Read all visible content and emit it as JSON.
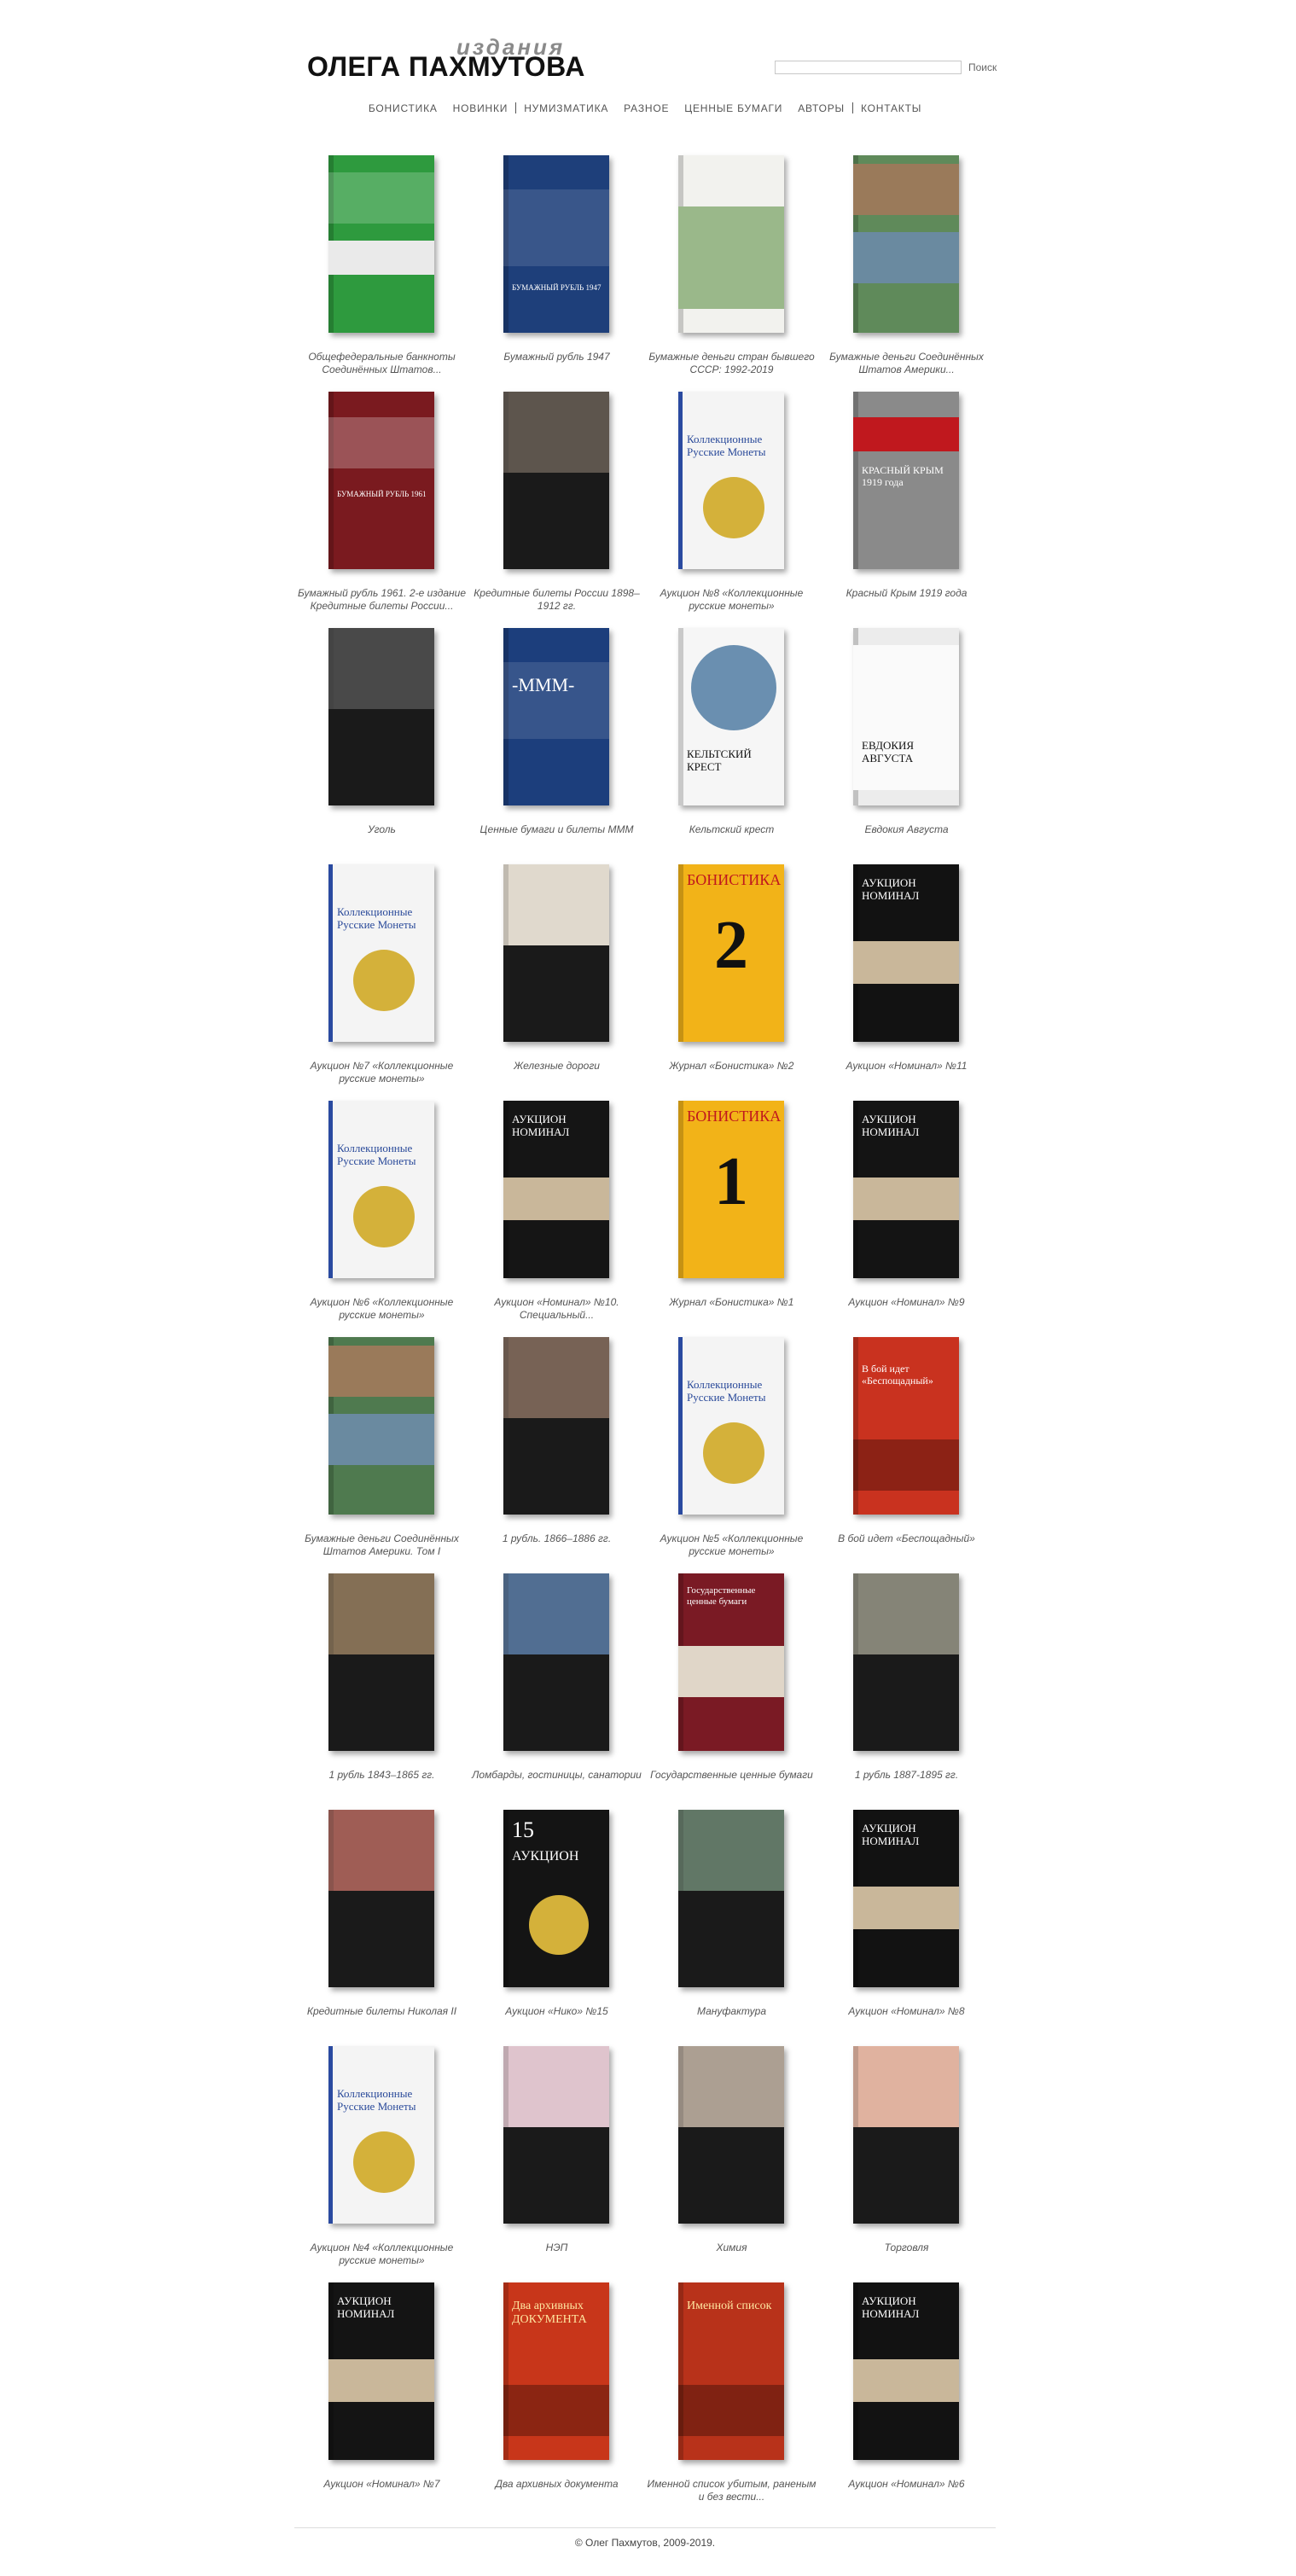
{
  "header": {
    "logo_top": "издания",
    "logo_main": "ОЛЕГА ПАХМУТОВА",
    "search_placeholder": "",
    "search_button": "Поиск"
  },
  "nav": [
    "БОНИСТИКА",
    "НОВИНКИ",
    "НУМИЗМАТИКА",
    "РАЗНОЕ",
    "ЦЕННЫЕ БУМАГИ",
    "АВТОРЫ",
    "КОНТАКТЫ"
  ],
  "books": [
    {
      "title": "Общефедеральные банкноты Соединённых Штатов...",
      "color": "#2e9a3e",
      "style": "green"
    },
    {
      "title": "Бумажный рубль 1947",
      "color": "#1e3f7a",
      "style": "navy"
    },
    {
      "title": "Бумажные деньги стран бывшего СССР: 1992-2019",
      "color": "#f2f2ee",
      "style": "light"
    },
    {
      "title": "Бумажные деньги Соединённых Штатов Америки...",
      "color": "#5f8a5a",
      "style": "collage"
    },
    {
      "title": "Бумажный рубль 1961. 2-е издание Кредитные билеты России...",
      "color": "#7a1a1f",
      "style": "maroon"
    },
    {
      "title": "Кредитные билеты России 1898–1912 гг.",
      "color": "#3a3026",
      "style": "darkband"
    },
    {
      "title": "Аукцион №8 «Коллекционные русские монеты»",
      "color": "#f4f4f4",
      "style": "coin"
    },
    {
      "title": "Красный Крым 1919 года",
      "color": "#8a8a8a",
      "style": "grey"
    },
    {
      "title": "Уголь",
      "color": "#222222",
      "style": "darkband"
    },
    {
      "title": "Ценные бумаги и билеты МММ",
      "color": "#1c3e7c",
      "style": "navy"
    },
    {
      "title": "Кельтский крест",
      "color": "#f6f6f6",
      "style": "photo"
    },
    {
      "title": "Евдокия Августа",
      "color": "#ececec",
      "style": "frame"
    },
    {
      "title": "Аукцион №7 «Коллекционные русские монеты»",
      "color": "#f4f4f4",
      "style": "coin"
    },
    {
      "title": "Железные дороги",
      "color": "#d9d1c2",
      "style": "darkband"
    },
    {
      "title": "Журнал «Бонистика» №2",
      "color": "#f2b318",
      "style": "yellow",
      "number": "2"
    },
    {
      "title": "Аукцион «Номинал» №11",
      "color": "#121212",
      "style": "black"
    },
    {
      "title": "Аукцион №6 «Коллекционные русские монеты»",
      "color": "#f4f4f4",
      "style": "coin"
    },
    {
      "title": "Аукцион «Номинал» №10. Специальный...",
      "color": "#151515",
      "style": "black"
    },
    {
      "title": "Журнал «Бонистика» №1",
      "color": "#f2b318",
      "style": "yellow",
      "number": "1"
    },
    {
      "title": "Аукцион «Номинал» №9",
      "color": "#141414",
      "style": "black"
    },
    {
      "title": "Бумажные деньги Соединённых Штатов Америки. Том I",
      "color": "#4f7a4f",
      "style": "collage"
    },
    {
      "title": "1 рубль. 1866–1886 гг.",
      "color": "#5a4030",
      "style": "darkband"
    },
    {
      "title": "Аукцион №5 «Коллекционные русские монеты»",
      "color": "#f4f4f4",
      "style": "coin"
    },
    {
      "title": "В бой идет «Беспощадный»",
      "color": "#c9321f",
      "style": "red"
    },
    {
      "title": "1 рубль 1843–1865 гг.",
      "color": "#6a5030",
      "style": "darkband"
    },
    {
      "title": "Ломбарды, гостиницы, санатории",
      "color": "#2b4f7a",
      "style": "darkband"
    },
    {
      "title": "Государственные ценные бумаги",
      "color": "#7a1a24",
      "style": "maroon"
    },
    {
      "title": "1 рубль 1887-1895 гг.",
      "color": "#6b6a5a",
      "style": "darkband"
    },
    {
      "title": "Кредитные билеты Николая II",
      "color": "#8a3a30",
      "style": "darkband"
    },
    {
      "title": "Аукцион «Нико» №15",
      "color": "#141414",
      "style": "coinblack"
    },
    {
      "title": "Мануфактура",
      "color": "#3f5a45",
      "style": "darkband"
    },
    {
      "title": "Аукцион «Номинал» №8",
      "color": "#121212",
      "style": "black"
    },
    {
      "title": "Аукцион №4 «Коллекционные русские монеты»",
      "color": "#f4f4f4",
      "style": "coin"
    },
    {
      "title": "НЭП",
      "color": "#d8b8c2",
      "style": "darkband"
    },
    {
      "title": "Химия",
      "color": "#9a8a7a",
      "style": "darkband"
    },
    {
      "title": "Торговля",
      "color": "#d9a28a",
      "style": "darkband"
    },
    {
      "title": "Аукцион «Номинал» №7",
      "color": "#141414",
      "style": "black"
    },
    {
      "title": "Два архивных документа",
      "color": "#c8361a",
      "style": "red"
    },
    {
      "title": "Именной список убитым, раненым и без вести...",
      "color": "#b8321a",
      "style": "red"
    },
    {
      "title": "Аукцион «Номинал» №6",
      "color": "#121212",
      "style": "black"
    }
  ],
  "cover_texts": {
    "nominal": "АУКЦИОН НОМИНАЛ",
    "bonistika": "БОНИСТИКА",
    "coins": "Коллекционные Русские Монеты",
    "nico": "АУКЦИОН",
    "nico_num": "15",
    "mmm": "-МММ-",
    "crimea": "КРАСНЫЙ КРЫМ 1919 года",
    "celtic": "КЕЛЬТСКИЙ КРЕСТ",
    "evdokia": "ЕВДОКИЯ АВГУСТА",
    "rubl1947": "БУМАЖНЫЙ РУБЛЬ 1947",
    "rubl1961": "БУМАЖНЫЙ РУБЛЬ 1961",
    "two_docs": "Два архивных ДОКУМЕНТА",
    "name_list": "Именной список",
    "boy": "В бой идет «Беспощадный»",
    "gos": "Государственные ценные бумаги"
  },
  "footer": {
    "text": "© Олег Пахмутов, 2009-2019."
  }
}
